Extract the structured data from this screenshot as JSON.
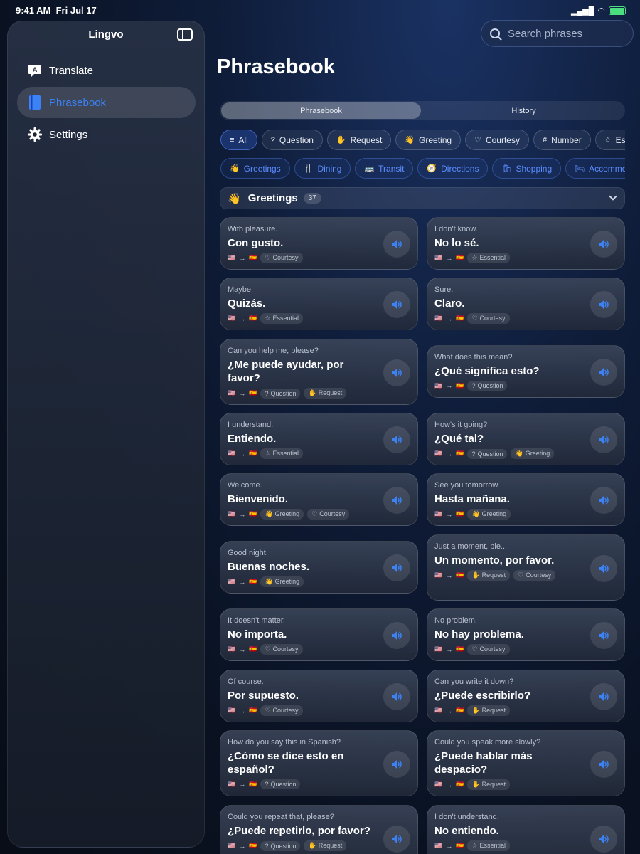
{
  "status": {
    "time": "9:41 AM",
    "date": "Fri Jul 17"
  },
  "sidebar": {
    "title": "Lingvo",
    "items": [
      {
        "label": "Translate",
        "icon": "translate-bubble-icon"
      },
      {
        "label": "Phrasebook",
        "icon": "book-icon",
        "active": true
      },
      {
        "label": "Settings",
        "icon": "gear-icon"
      }
    ]
  },
  "search": {
    "placeholder": "Search phrases"
  },
  "page": {
    "title": "Phrasebook"
  },
  "segment": {
    "options": [
      "Phrasebook",
      "History"
    ],
    "selected": "Phrasebook"
  },
  "type_chips": [
    {
      "label": "All",
      "icon": "≡"
    },
    {
      "label": "Question",
      "icon": "?"
    },
    {
      "label": "Request",
      "icon": "✋"
    },
    {
      "label": "Greeting",
      "icon": "👋"
    },
    {
      "label": "Courtesy",
      "icon": "♡"
    },
    {
      "label": "Number",
      "icon": "#"
    },
    {
      "label": "Essential",
      "icon": "☆"
    }
  ],
  "topic_chips": [
    {
      "label": "Greetings",
      "icon": "👋"
    },
    {
      "label": "Dining",
      "icon": "🍴"
    },
    {
      "label": "Transit",
      "icon": "🚌"
    },
    {
      "label": "Directions",
      "icon": "🧭"
    },
    {
      "label": "Shopping",
      "icon": "🛍"
    },
    {
      "label": "Accommodation",
      "icon": "🛏"
    }
  ],
  "section": {
    "title": "Greetings",
    "count": "37"
  },
  "flags": {
    "from": "🇺🇸",
    "arrow": "→",
    "to": "🇪🇸"
  },
  "tag_icons": {
    "Courtesy": "♡",
    "Essential": "☆",
    "Question": "?",
    "Request": "✋",
    "Greeting": "👋"
  },
  "phrases": [
    {
      "en": "With pleasure.",
      "es": "Con gusto.",
      "tags": [
        "Courtesy"
      ]
    },
    {
      "en": "I don't know.",
      "es": "No lo sé.",
      "tags": [
        "Essential"
      ]
    },
    {
      "en": "Maybe.",
      "es": "Quizás.",
      "tags": [
        "Essential"
      ]
    },
    {
      "en": "Sure.",
      "es": "Claro.",
      "tags": [
        "Courtesy"
      ]
    },
    {
      "en": "Can you help me, please?",
      "es": "¿Me puede ayudar, por favor?",
      "tags": [
        "Question",
        "Request"
      ]
    },
    {
      "en": "What does this mean?",
      "es": "¿Qué significa esto?",
      "tags": [
        "Question"
      ]
    },
    {
      "en": "I understand.",
      "es": "Entiendo.",
      "tags": [
        "Essential"
      ]
    },
    {
      "en": "How's it going?",
      "es": "¿Qué tal?",
      "tags": [
        "Question",
        "Greeting"
      ]
    },
    {
      "en": "Welcome.",
      "es": "Bienvenido.",
      "tags": [
        "Greeting",
        "Courtesy"
      ]
    },
    {
      "en": "See you tomorrow.",
      "es": "Hasta mañana.",
      "tags": [
        "Greeting"
      ]
    },
    {
      "en": "Good night.",
      "es": "Buenas noches.",
      "tags": [
        "Greeting"
      ]
    },
    {
      "en": "Just a moment, ple...",
      "es": "Un momento, por favor.",
      "tags": [
        "Request",
        "Courtesy"
      ]
    },
    {
      "en": "It doesn't matter.",
      "es": "No importa.",
      "tags": [
        "Courtesy"
      ]
    },
    {
      "en": "No problem.",
      "es": "No hay problema.",
      "tags": [
        "Courtesy"
      ]
    },
    {
      "en": "Of course.",
      "es": "Por supuesto.",
      "tags": [
        "Courtesy"
      ]
    },
    {
      "en": "Can you write it down?",
      "es": "¿Puede escribirlo?",
      "tags": [
        "Request"
      ]
    },
    {
      "en": "How do you say this in Spanish?",
      "es": "¿Cómo se dice esto en español?",
      "tags": [
        "Question"
      ]
    },
    {
      "en": "Could you speak more slowly?",
      "es": "¿Puede hablar más despacio?",
      "tags": [
        "Request"
      ]
    },
    {
      "en": "Could you repeat that, please?",
      "es": "¿Puede repetirlo, por favor?",
      "tags": [
        "Question",
        "Request"
      ]
    },
    {
      "en": "I don't understand.",
      "es": "No entiendo.",
      "tags": [
        "Essential"
      ]
    }
  ]
}
